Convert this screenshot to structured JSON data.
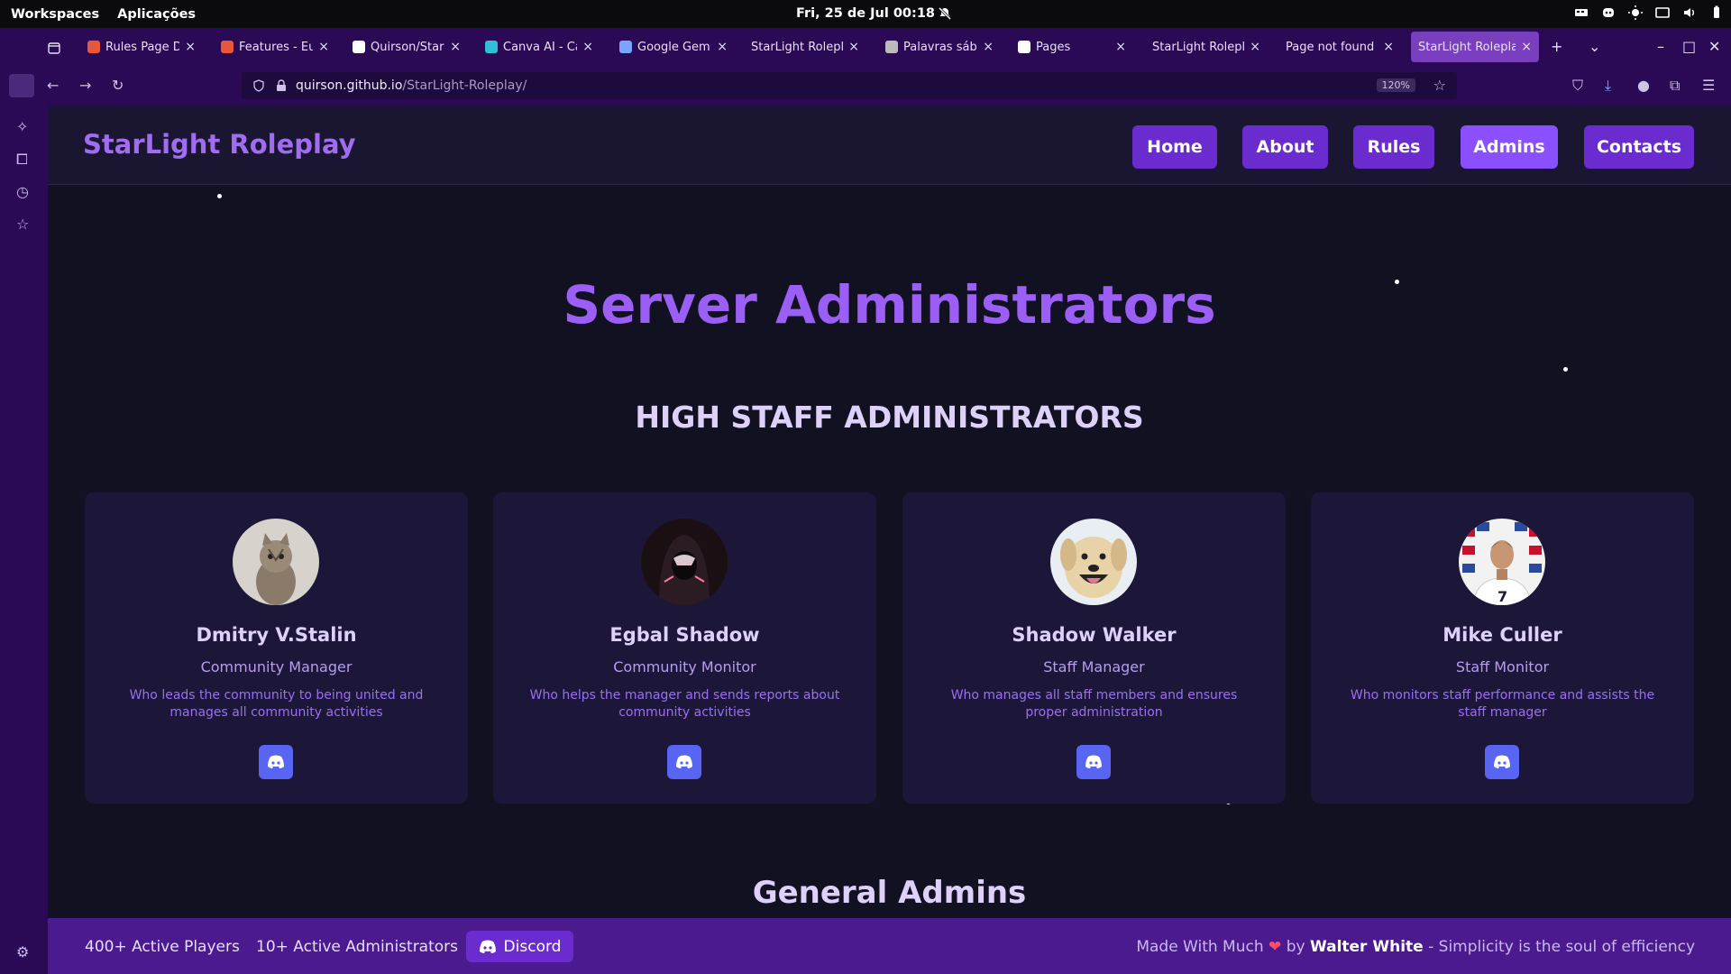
{
  "system_bar": {
    "workspaces": "Workspaces",
    "apps": "Aplicações",
    "clock": "Fri, 25 de Jul  00:18"
  },
  "tabs": [
    {
      "title": "Rules Page Das",
      "color": "#e8573c"
    },
    {
      "title": "Features - Euro",
      "color": "#e8573c"
    },
    {
      "title": "Quirson/StarLi",
      "color": "#ffffff"
    },
    {
      "title": "Canva AI - Canv",
      "color": "#2fbfd6"
    },
    {
      "title": "Google Gemini",
      "color": "#7aa4ff"
    },
    {
      "title": "StarLight Roleplay",
      "color": ""
    },
    {
      "title": "Palavras sábias",
      "color": "#bbbbbb"
    },
    {
      "title": "Pages",
      "color": "#ffffff"
    },
    {
      "title": "StarLight Roleplay",
      "color": ""
    },
    {
      "title": "Page not found · G",
      "color": ""
    },
    {
      "title": "StarLight Roleplay",
      "color": ""
    }
  ],
  "address": {
    "host": "quirson.github.io",
    "path": "/StarLight-Roleplay/",
    "zoom": "120%"
  },
  "site": {
    "brand": "StarLight Roleplay",
    "nav": {
      "home": "Home",
      "about": "About",
      "rules": "Rules",
      "admins": "Admins",
      "contacts": "Contacts"
    },
    "title": "Server Administrators",
    "high_staff_title": "HIGH STAFF ADMINISTRATORS",
    "general_title": "General Admins"
  },
  "admins": [
    {
      "name": "Dmitry V.Stalin",
      "role": "Community Manager",
      "description": "Who leads the community to being united and manages all community activities"
    },
    {
      "name": "Egbal Shadow",
      "role": "Community Monitor",
      "description": "Who helps the manager and sends reports about community activities"
    },
    {
      "name": "Shadow Walker",
      "role": "Staff Manager",
      "description": "Who manages all staff members and ensures proper administration"
    },
    {
      "name": "Mike Culler",
      "role": "Staff Monitor",
      "description": "Who monitors staff performance and assists the staff manager"
    }
  ],
  "footer": {
    "players": "400+ Active Players",
    "admins": "10+ Active Administrators",
    "discord": "Discord",
    "credit_prefix": "Made With Much",
    "credit_by": "by",
    "credit_author": "Walter White",
    "credit_suffix": "- Simplicity is the soul of efficiency"
  },
  "colors": {
    "accent": "#9b5ff5",
    "nav_button": "#6a2ccf",
    "discord": "#5865f2",
    "footer": "#4a1a8e"
  }
}
